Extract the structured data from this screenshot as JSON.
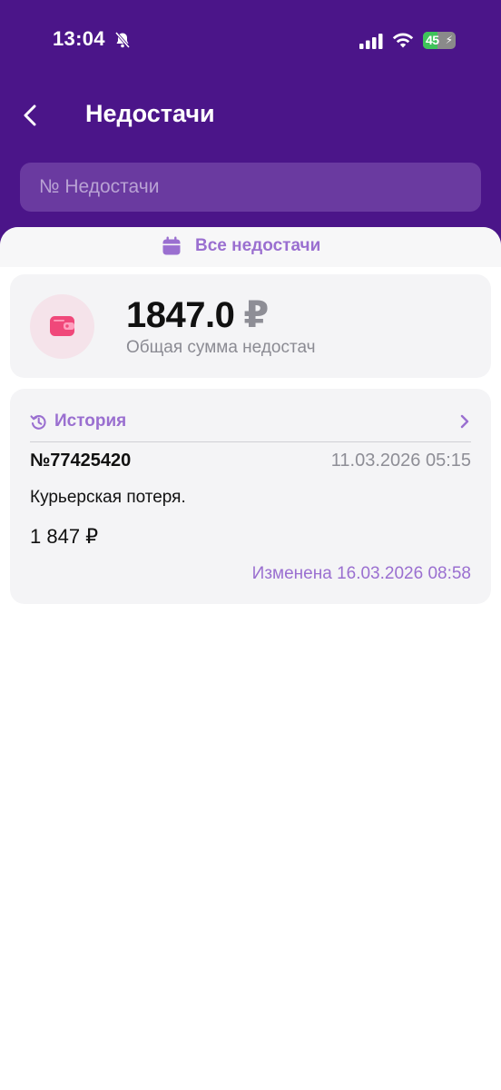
{
  "status_bar": {
    "time": "13:04",
    "battery_level": "45",
    "battery_charge": 0.45,
    "icons": [
      "bell-off-icon",
      "signal-icon",
      "wifi-icon",
      "battery-icon",
      "bolt-icon"
    ]
  },
  "header": {
    "title": "Недостачи",
    "back_icon": "chevron-left-icon"
  },
  "search": {
    "placeholder": "№ Недостачи",
    "value": ""
  },
  "filter": {
    "label": "Все недостачи",
    "icon": "calendar-icon"
  },
  "total": {
    "amount": "1847.0",
    "currency": "₽",
    "caption": "Общая сумма недостач",
    "icon": "wallet-icon"
  },
  "history": {
    "title": "История",
    "icon": "history-icon",
    "chevron": "chevron-right-icon",
    "item": {
      "number": "№77425420",
      "date": "11.03.2026 05:15",
      "reason": "Курьерская потеря.",
      "sum": "1 847 ₽",
      "modified": "Изменена 16.03.2026 08:58"
    }
  },
  "colors": {
    "header_bg": "#4b1589",
    "accent": "#9a6fd0",
    "wallet": "#f0487a",
    "card_bg": "#f4f4f6"
  }
}
